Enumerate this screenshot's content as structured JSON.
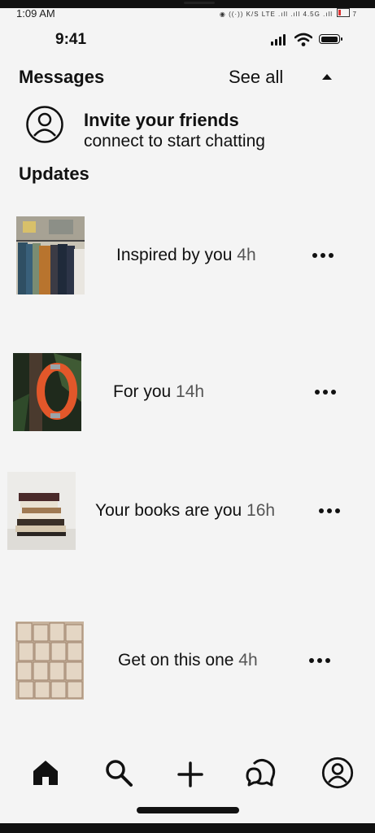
{
  "system_status": {
    "time": "1:09 AM",
    "indicators": "◉ ((·)) K/S LTE .ıll .ıll 4.5G .ıll",
    "battery": "7"
  },
  "device_status": {
    "clock": "9:41"
  },
  "messages": {
    "heading": "Messages",
    "see_all": "See all",
    "invite_title": "Invite your friends",
    "invite_subtitle": "connect to start chatting"
  },
  "updates": {
    "heading": "Updates",
    "items": [
      {
        "text": "Inspired by you",
        "time": "4h",
        "thumb": "clothes-rack"
      },
      {
        "text": "For you",
        "time": "14h",
        "thumb": "life-ring"
      },
      {
        "text": "Your books are you",
        "time": "16h",
        "thumb": "book-stack"
      },
      {
        "text": "Get on this one",
        "time": "4h",
        "thumb": "book-pages"
      }
    ]
  },
  "nav": {
    "items": [
      {
        "icon": "home-icon"
      },
      {
        "icon": "search-icon"
      },
      {
        "icon": "plus-icon"
      },
      {
        "icon": "chat-icon"
      },
      {
        "icon": "profile-icon"
      }
    ]
  }
}
